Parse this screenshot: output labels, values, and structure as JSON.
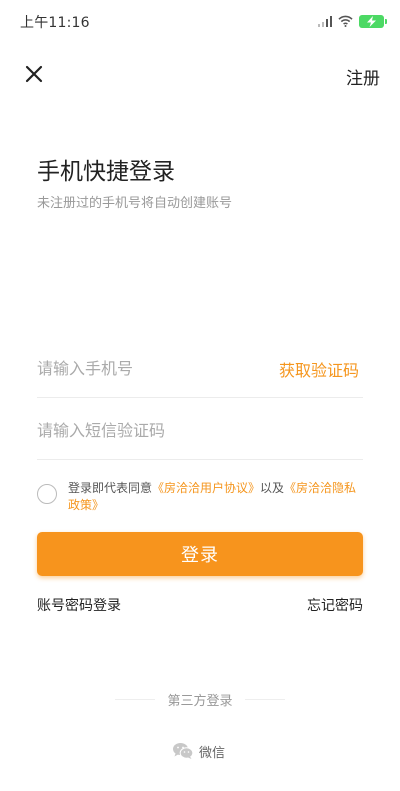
{
  "status_bar": {
    "time": "上午11:16",
    "icons": [
      "signal-icon",
      "wifi-icon",
      "battery-charging-icon"
    ]
  },
  "nav": {
    "close_icon": "close-icon",
    "register_label": "注册"
  },
  "header": {
    "title": "手机快捷登录",
    "subtitle": "未注册过的手机号将自动创建账号"
  },
  "form": {
    "phone_placeholder": "请输入手机号",
    "get_code_label": "获取验证码",
    "code_placeholder": "请输入短信验证码",
    "agreement_prefix": "登录即代表同意",
    "agreement_link1": "《房洽洽用户协议》",
    "agreement_mid": "以及",
    "agreement_link2": "《房洽洽隐私政策》",
    "agreement_checked": false,
    "login_label": "登录",
    "alt_login_label": "账号密码登录",
    "forgot_label": "忘记密码"
  },
  "third_party": {
    "label": "第三方登录",
    "wechat_label": "微信",
    "wechat_icon": "wechat-icon"
  },
  "colors": {
    "accent": "#f7941d",
    "link": "#f5961e",
    "battery": "#4cd964"
  }
}
